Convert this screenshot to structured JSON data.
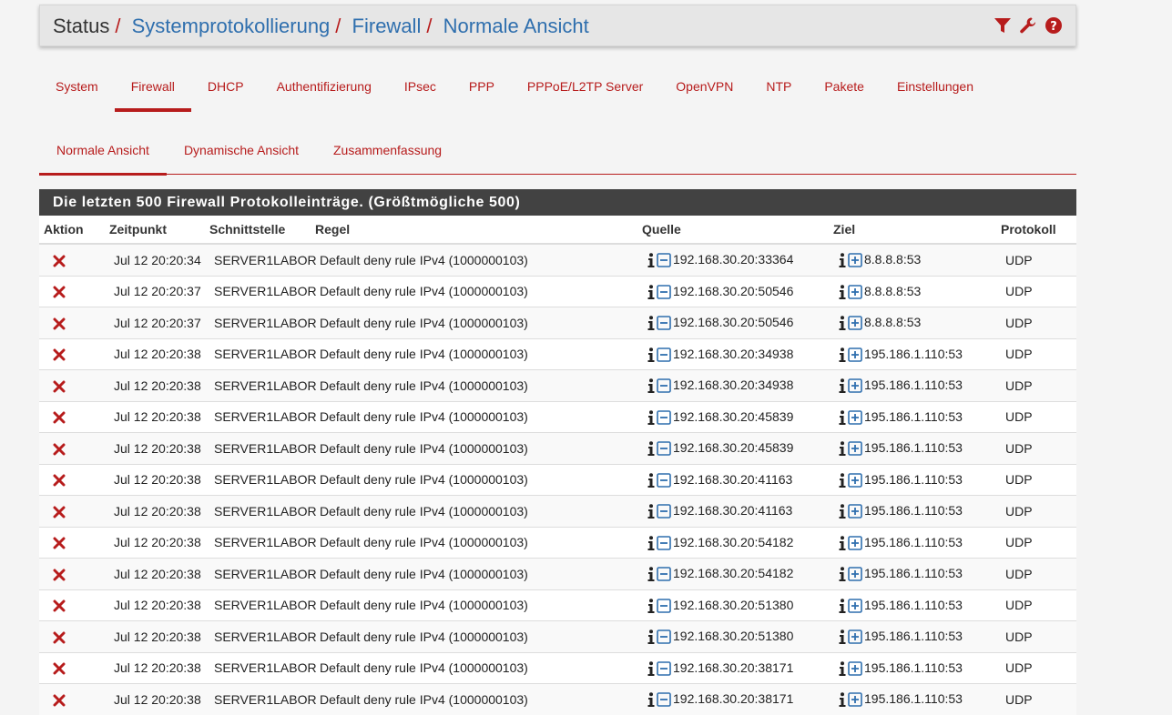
{
  "breadcrumb": {
    "root": "Status",
    "links": [
      "Systemprotokollierung",
      "Firewall",
      "Normale Ansicht"
    ]
  },
  "header_icons": [
    "filter-icon",
    "wrench-icon",
    "help-icon"
  ],
  "accent_color": "#b71c1c",
  "link_color": "#2f6fae",
  "tabs_primary": [
    {
      "label": "System",
      "active": false
    },
    {
      "label": "Firewall",
      "active": true
    },
    {
      "label": "DHCP",
      "active": false
    },
    {
      "label": "Authentifizierung",
      "active": false
    },
    {
      "label": "IPsec",
      "active": false
    },
    {
      "label": "PPP",
      "active": false
    },
    {
      "label": "PPPoE/L2TP Server",
      "active": false
    },
    {
      "label": "OpenVPN",
      "active": false
    },
    {
      "label": "NTP",
      "active": false
    },
    {
      "label": "Pakete",
      "active": false
    },
    {
      "label": "Einstellungen",
      "active": false
    }
  ],
  "tabs_secondary": [
    {
      "label": "Normale Ansicht",
      "active": true
    },
    {
      "label": "Dynamische Ansicht",
      "active": false
    },
    {
      "label": "Zusammenfassung",
      "active": false
    }
  ],
  "panel": {
    "title": "Die letzten 500 Firewall Protokolleinträge. (Größtmögliche 500)",
    "columns": [
      "Aktion",
      "Zeitpunkt",
      "Schnittstelle",
      "Regel",
      "Quelle",
      "Ziel",
      "Protokoll"
    ],
    "rows": [
      {
        "action": "block",
        "time": "Jul 12 20:20:34",
        "iface": "SERVER1LABOR",
        "rule": "Default deny rule IPv4 (1000000103)",
        "src": "192.168.30.20:33364",
        "dst": "8.8.8.8:53",
        "proto": "UDP"
      },
      {
        "action": "block",
        "time": "Jul 12 20:20:37",
        "iface": "SERVER1LABOR",
        "rule": "Default deny rule IPv4 (1000000103)",
        "src": "192.168.30.20:50546",
        "dst": "8.8.8.8:53",
        "proto": "UDP"
      },
      {
        "action": "block",
        "time": "Jul 12 20:20:37",
        "iface": "SERVER1LABOR",
        "rule": "Default deny rule IPv4 (1000000103)",
        "src": "192.168.30.20:50546",
        "dst": "8.8.8.8:53",
        "proto": "UDP"
      },
      {
        "action": "block",
        "time": "Jul 12 20:20:38",
        "iface": "SERVER1LABOR",
        "rule": "Default deny rule IPv4 (1000000103)",
        "src": "192.168.30.20:34938",
        "dst": "195.186.1.110:53",
        "proto": "UDP"
      },
      {
        "action": "block",
        "time": "Jul 12 20:20:38",
        "iface": "SERVER1LABOR",
        "rule": "Default deny rule IPv4 (1000000103)",
        "src": "192.168.30.20:34938",
        "dst": "195.186.1.110:53",
        "proto": "UDP"
      },
      {
        "action": "block",
        "time": "Jul 12 20:20:38",
        "iface": "SERVER1LABOR",
        "rule": "Default deny rule IPv4 (1000000103)",
        "src": "192.168.30.20:45839",
        "dst": "195.186.1.110:53",
        "proto": "UDP"
      },
      {
        "action": "block",
        "time": "Jul 12 20:20:38",
        "iface": "SERVER1LABOR",
        "rule": "Default deny rule IPv4 (1000000103)",
        "src": "192.168.30.20:45839",
        "dst": "195.186.1.110:53",
        "proto": "UDP"
      },
      {
        "action": "block",
        "time": "Jul 12 20:20:38",
        "iface": "SERVER1LABOR",
        "rule": "Default deny rule IPv4 (1000000103)",
        "src": "192.168.30.20:41163",
        "dst": "195.186.1.110:53",
        "proto": "UDP"
      },
      {
        "action": "block",
        "time": "Jul 12 20:20:38",
        "iface": "SERVER1LABOR",
        "rule": "Default deny rule IPv4 (1000000103)",
        "src": "192.168.30.20:41163",
        "dst": "195.186.1.110:53",
        "proto": "UDP"
      },
      {
        "action": "block",
        "time": "Jul 12 20:20:38",
        "iface": "SERVER1LABOR",
        "rule": "Default deny rule IPv4 (1000000103)",
        "src": "192.168.30.20:54182",
        "dst": "195.186.1.110:53",
        "proto": "UDP"
      },
      {
        "action": "block",
        "time": "Jul 12 20:20:38",
        "iface": "SERVER1LABOR",
        "rule": "Default deny rule IPv4 (1000000103)",
        "src": "192.168.30.20:54182",
        "dst": "195.186.1.110:53",
        "proto": "UDP"
      },
      {
        "action": "block",
        "time": "Jul 12 20:20:38",
        "iface": "SERVER1LABOR",
        "rule": "Default deny rule IPv4 (1000000103)",
        "src": "192.168.30.20:51380",
        "dst": "195.186.1.110:53",
        "proto": "UDP"
      },
      {
        "action": "block",
        "time": "Jul 12 20:20:38",
        "iface": "SERVER1LABOR",
        "rule": "Default deny rule IPv4 (1000000103)",
        "src": "192.168.30.20:51380",
        "dst": "195.186.1.110:53",
        "proto": "UDP"
      },
      {
        "action": "block",
        "time": "Jul 12 20:20:38",
        "iface": "SERVER1LABOR",
        "rule": "Default deny rule IPv4 (1000000103)",
        "src": "192.168.30.20:38171",
        "dst": "195.186.1.110:53",
        "proto": "UDP"
      },
      {
        "action": "block",
        "time": "Jul 12 20:20:38",
        "iface": "SERVER1LABOR",
        "rule": "Default deny rule IPv4 (1000000103)",
        "src": "192.168.30.20:38171",
        "dst": "195.186.1.110:53",
        "proto": "UDP"
      }
    ]
  }
}
